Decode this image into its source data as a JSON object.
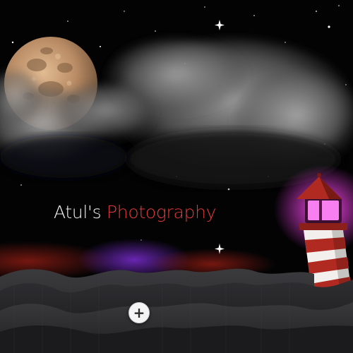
{
  "hero": {
    "title_part1": "Atul's",
    "title_part2": "Photography"
  },
  "actions": {
    "add_label": "+"
  },
  "colors": {
    "title_white": "#f1f1f1",
    "title_red": "#e23a3a",
    "lighthouse_red": "#b02a22",
    "lighthouse_light": "#e24fd8",
    "sea": "#2a2a2c"
  },
  "icons": {
    "add": "plus-icon",
    "moon": "moon-icon",
    "lighthouse": "lighthouse-icon"
  }
}
